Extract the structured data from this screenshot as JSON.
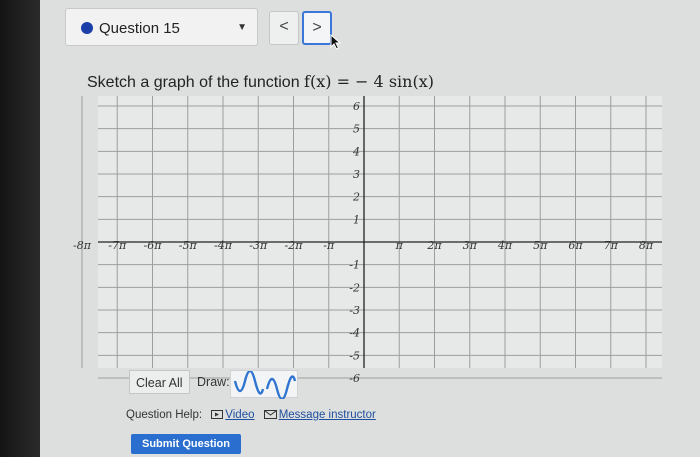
{
  "question": {
    "label": "Question 15",
    "dot_color": "#1b3ea8"
  },
  "nav": {
    "prev": "<",
    "next": ">"
  },
  "prompt": {
    "text": "Sketch a graph of the function",
    "math": "f(x) = − 4 sin(x)"
  },
  "graph": {
    "x_ticks": [
      "-8π",
      "-7π",
      "-6π",
      "-5π",
      "-4π",
      "-3π",
      "-2π",
      "-π",
      "π",
      "2π",
      "3π",
      "4π",
      "5π",
      "6π",
      "7π",
      "8π"
    ],
    "y_ticks_pos": [
      "6",
      "5",
      "4",
      "3",
      "2",
      "1"
    ],
    "y_ticks_neg": [
      "-1",
      "-2",
      "-3",
      "-4",
      "-5",
      "-6"
    ],
    "x_range": [
      -8,
      8
    ],
    "y_range": [
      -6,
      6
    ],
    "grid": true
  },
  "toolbar": {
    "clear_all": "Clear All",
    "draw_label": "Draw:",
    "tools": [
      "wave-tool-1",
      "wave-tool-2"
    ],
    "accent": "#2f74d0"
  },
  "help": {
    "label": "Question Help:",
    "video": "Video",
    "message": "Message instructor"
  },
  "submit": {
    "label": "Submit Question",
    "color": "#2a6fcf"
  }
}
